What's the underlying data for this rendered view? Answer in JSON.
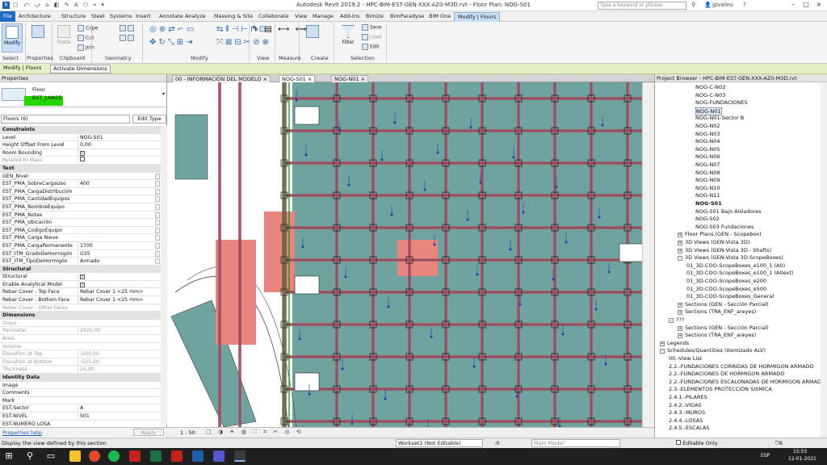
{
  "window": {
    "title": "Autodesk Revit 2019.2 - HPC-BIM-EST-GEN-XXX-AZ0-M3D.rvt - Floor Plan: NOG-S01",
    "search_placeholder": "Type a keyword or phrase",
    "user": "jpvaleu"
  },
  "ribbon_tabs": [
    "File",
    "Architecture",
    "Structure",
    "Steel",
    "Systems",
    "Insert",
    "Annotate",
    "Analyze",
    "Massing & Site",
    "Collaborate",
    "View",
    "Manage",
    "Add-Ins",
    "Bimize",
    "BimParadyse",
    "BIM One",
    "Modify | Floors"
  ],
  "ribbon": {
    "modify": "Modify",
    "paste": "Paste",
    "cope": "Cope",
    "cut": "Cut",
    "join": "Join",
    "filter": "Filter",
    "save": "Save",
    "load": "Load",
    "edit": "Edit",
    "panels": [
      "Select",
      "Properties",
      "Clipboard",
      "Geometry",
      "Modify",
      "View",
      "Measure",
      "Create",
      "Selection"
    ]
  },
  "context_bar": {
    "label": "Modify | Floors",
    "button": "Activate Dimensions"
  },
  "properties": {
    "header": "Properties",
    "type_family": "Floor",
    "type_name": "EST_LHA25",
    "selector": "Floors (6)",
    "edit_type": "Edit Type",
    "rows": [
      {
        "kind": "section",
        "k": "Constraints"
      },
      {
        "k": "Level",
        "v": "NOG-S01"
      },
      {
        "k": "Height Offset From Level",
        "v": "0,00"
      },
      {
        "k": "Room Bounding",
        "v": "",
        "check": true
      },
      {
        "k": "Related to Mass",
        "v": "",
        "check": false,
        "dis": true
      },
      {
        "kind": "section",
        "k": "Text"
      },
      {
        "k": "GEN_Nivel",
        "v": ""
      },
      {
        "k": "EST_PMA_SobreCargaUso",
        "v": "400"
      },
      {
        "k": "EST_PMA_CargaDistribución",
        "v": ""
      },
      {
        "k": "EST_PMA_CantidadEquipos",
        "v": ""
      },
      {
        "k": "EST_PMA_NombreEquipo",
        "v": ""
      },
      {
        "k": "EST_PMA_Notas",
        "v": ""
      },
      {
        "k": "EST_PMA_Ubicación",
        "v": ""
      },
      {
        "k": "EST_PMA_CodigoEquipo",
        "v": ""
      },
      {
        "k": "EST_PMA_Carga Nieve",
        "v": ""
      },
      {
        "k": "EST_PMA_CargaPermanente",
        "v": "1700"
      },
      {
        "k": "EST_ITM_GradoDeHormigón",
        "v": "G35"
      },
      {
        "k": "EST_ITM_TipoDeHormigón",
        "v": "Armado"
      },
      {
        "kind": "section",
        "k": "Structural"
      },
      {
        "k": "Structural",
        "v": "",
        "check": true
      },
      {
        "k": "Enable Analytical Model",
        "v": "",
        "check": true
      },
      {
        "k": "Rebar Cover - Top Face",
        "v": "Rebar Cover 1 <25 mm>"
      },
      {
        "k": "Rebar Cover - Bottom Face",
        "v": "Rebar Cover 1 <25 mm>"
      },
      {
        "k": "Rebar Cover - Other Faces",
        "v": "",
        "dis": true
      },
      {
        "kind": "section",
        "k": "Dimensions"
      },
      {
        "k": "Slope",
        "v": "",
        "dis": true
      },
      {
        "k": "Perimeter",
        "v": "2920,00",
        "dis": true
      },
      {
        "k": "Area",
        "v": "",
        "dis": true
      },
      {
        "k": "Volume",
        "v": "",
        "dis": true
      },
      {
        "k": "Elevation at Top",
        "v": "-500,00",
        "dis": true
      },
      {
        "k": "Elevation at Bottom",
        "v": "-525,00",
        "dis": true
      },
      {
        "k": "Thickness",
        "v": "25,00",
        "dis": true
      },
      {
        "kind": "section",
        "k": "Identity Data"
      },
      {
        "k": "Image",
        "v": ""
      },
      {
        "k": "Comments",
        "v": ""
      },
      {
        "k": "Mark",
        "v": ""
      },
      {
        "k": "EST-Sector",
        "v": "A"
      },
      {
        "k": "EST-NIVEL",
        "v": "S01"
      },
      {
        "k": "EST-NUMERO LOSA",
        "v": ""
      }
    ],
    "help": "Properties help",
    "apply": "Apply"
  },
  "view_tabs": [
    "00 - INFORMACIÓN DEL MODELO",
    "NOG-S01",
    "NOG-N01"
  ],
  "view_control": {
    "scale": "1 : 50"
  },
  "browser": {
    "title": "Project Browser - HPC-BIM-EST-GEN-XXX-AZ0-M3D.rvt",
    "nodes": [
      {
        "t": "NOG-C-N02",
        "l": 4
      },
      {
        "t": "NOG-C-N03",
        "l": 4
      },
      {
        "t": "NOG-FUNDACIONES",
        "l": 4
      },
      {
        "t": "NOG-N01",
        "l": 4,
        "sel": true
      },
      {
        "t": "NOG-N01-Sector B",
        "l": 4
      },
      {
        "t": "NOG-N02",
        "l": 4
      },
      {
        "t": "NOG-N03",
        "l": 4
      },
      {
        "t": "NOG-N04",
        "l": 4
      },
      {
        "t": "NOG-N05",
        "l": 4
      },
      {
        "t": "NOG-N06",
        "l": 4
      },
      {
        "t": "NOG-N07",
        "l": 4
      },
      {
        "t": "NOG-N08",
        "l": 4
      },
      {
        "t": "NOG-N09",
        "l": 4
      },
      {
        "t": "NOG-N10",
        "l": 4
      },
      {
        "t": "NOG-N11",
        "l": 4
      },
      {
        "t": "NOG-S01",
        "l": 4,
        "bold": true
      },
      {
        "t": "NOG-S01 Bajo Aisladores",
        "l": 4
      },
      {
        "t": "NOG-S02",
        "l": 4
      },
      {
        "t": "NOG-S03 Fundaciones",
        "l": 4
      },
      {
        "t": "Floor Plans (GEN - Scopebox)",
        "l": 2,
        "exp": "+"
      },
      {
        "t": "3D Views (GEN-Vista 3D)",
        "l": 2,
        "exp": "+"
      },
      {
        "t": "3D Views (GEN-Vista 3D - Shafts)",
        "l": 2,
        "exp": "+"
      },
      {
        "t": "3D Views (GEN-Vista 3D-ScopeBoxes)",
        "l": 2,
        "exp": "-"
      },
      {
        "t": "01_3D-COO-ScopeBoxes_e100_1 (A0)",
        "l": 3
      },
      {
        "t": "01_3D-COO-ScopeBoxes_e100_1 (A0ext)",
        "l": 3
      },
      {
        "t": "01_3D-COO-ScopeBoxes_e200",
        "l": 3
      },
      {
        "t": "01_3D-COO-ScopeBoxes_e500",
        "l": 3
      },
      {
        "t": "01_3D-COO-ScopeBoxes_General",
        "l": 3
      },
      {
        "t": "Sections (GEN - Sección Parcial)",
        "l": 2,
        "exp": "+"
      },
      {
        "t": "Sections (TRA_ENF_areyes)",
        "l": 2,
        "exp": "+"
      },
      {
        "t": "???",
        "l": 1,
        "exp": "-"
      },
      {
        "t": "Sections (GEN - Sección Parcial)",
        "l": 2,
        "exp": "+"
      },
      {
        "t": "Sections (TRA_ENF_areyes)",
        "l": 2,
        "exp": "+"
      },
      {
        "t": "Legends",
        "l": 0,
        "exp": "+"
      },
      {
        "t": "Schedules/Quantities (Itemizado ALV)",
        "l": 0,
        "exp": "-"
      },
      {
        "t": "00.-View List",
        "l": 1
      },
      {
        "t": "2.2.-FUNDACIONES CORRIDAS DE HORMIGON ARMADO",
        "l": 1
      },
      {
        "t": "2.2.-FUNDACIONES DE HORMIGON ARMADO",
        "l": 1
      },
      {
        "t": "2.2.-FUNDACIONES ESCALONADAS DE HORMIGON ARMADO",
        "l": 1
      },
      {
        "t": "2.3.-ELEMENTOS PROTECCIÓN SISMICA",
        "l": 1
      },
      {
        "t": "2.4.1.-PILARES",
        "l": 1
      },
      {
        "t": "2.4.2.-VIGAS",
        "l": 1
      },
      {
        "t": "2.4.3.-MUROS",
        "l": 1
      },
      {
        "t": "2.4.4.-LOSAS",
        "l": 1
      },
      {
        "t": "2.4.5.-ESCALAS",
        "l": 1
      }
    ]
  },
  "status": {
    "hint": "Display the view defined by this section",
    "workset": "Workset1 (Not Editable)",
    "zero": ":0",
    "model": "Main Model",
    "editable_only": "Editable Only",
    "filter_count": "6"
  },
  "taskbar": {
    "time": "15:55",
    "date": "12-01-2021",
    "lang": "ESP"
  },
  "colors": {
    "slab": "#6fa3a0",
    "highlight": "#e8857f",
    "beam": "#b0566b"
  }
}
